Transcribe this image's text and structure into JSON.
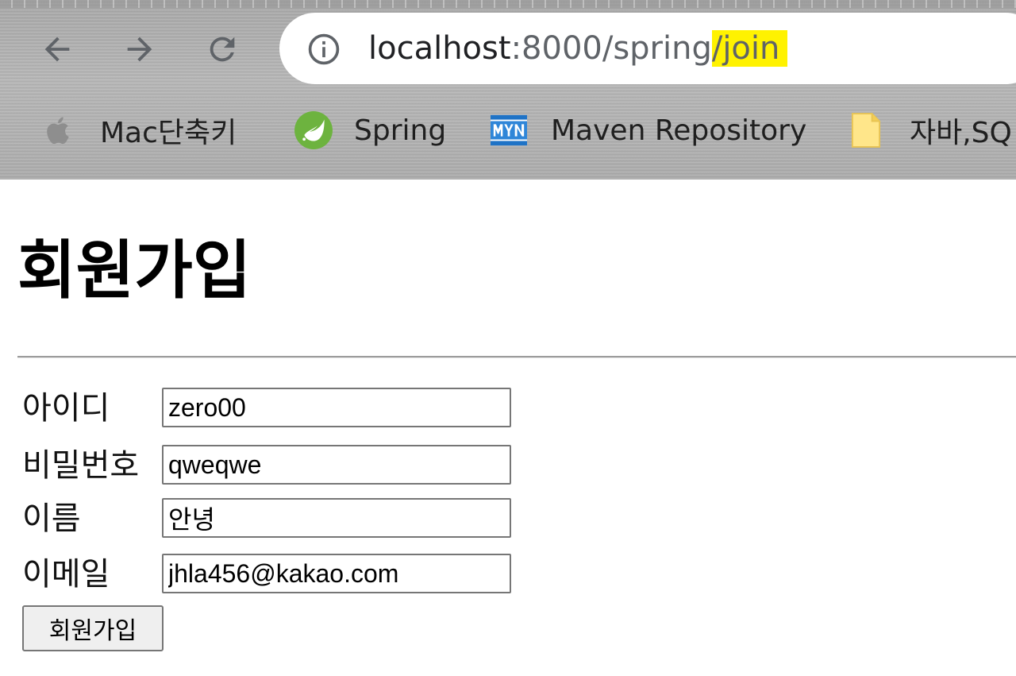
{
  "browser": {
    "nav": {
      "back_icon": "arrow-left-icon",
      "forward_icon": "arrow-right-icon",
      "reload_icon": "reload-icon"
    },
    "address_bar": {
      "info_icon": "info-circle-icon",
      "host": "localhost",
      "port_path": ":8000/spring",
      "highlighted_path": "/join",
      "highlight_color": "#fff200"
    },
    "bookmarks": [
      {
        "label": "Mac단축키",
        "icon": "apple-icon"
      },
      {
        "label": "Spring",
        "icon": "spring-leaf-icon"
      },
      {
        "label": "Maven Repository",
        "icon": "mvn-icon"
      },
      {
        "label": "자바,SQ",
        "icon": "folder-icon"
      }
    ]
  },
  "page": {
    "title": "회원가입",
    "form": {
      "fields": [
        {
          "label": "아이디",
          "value": "zero00"
        },
        {
          "label": "비밀번호",
          "value": "qweqwe"
        },
        {
          "label": "이름",
          "value": "안녕"
        },
        {
          "label": "이메일",
          "value": "jhla456@kakao.com"
        }
      ],
      "submit_label": "회원가입"
    }
  }
}
